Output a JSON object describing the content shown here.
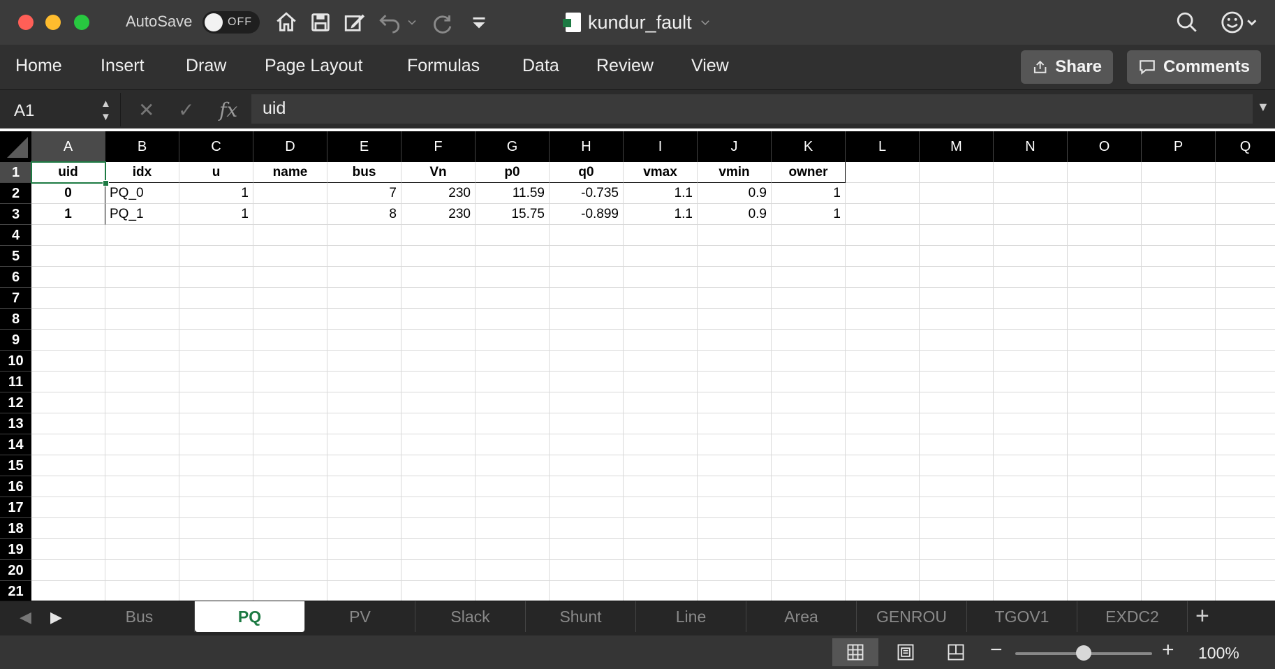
{
  "titlebar": {
    "autosave_label": "AutoSave",
    "autosave_state": "OFF",
    "document_title": "kundur_fault"
  },
  "ribbon": {
    "tabs": [
      "Home",
      "Insert",
      "Draw",
      "Page Layout",
      "Formulas",
      "Data",
      "Review",
      "View"
    ],
    "share_label": "Share",
    "comments_label": "Comments"
  },
  "formula_bar": {
    "name_box": "A1",
    "value": "uid"
  },
  "sheet": {
    "columns": [
      "A",
      "B",
      "C",
      "D",
      "E",
      "F",
      "G",
      "H",
      "I",
      "J",
      "K",
      "L",
      "M",
      "N",
      "O",
      "P",
      "Q"
    ],
    "rows": [
      "1",
      "2",
      "3",
      "4",
      "5",
      "6",
      "7",
      "8",
      "9",
      "10",
      "11",
      "12",
      "13",
      "14",
      "15",
      "16",
      "17",
      "18",
      "19",
      "20",
      "21"
    ],
    "header_row": [
      "uid",
      "idx",
      "u",
      "name",
      "bus",
      "Vn",
      "p0",
      "q0",
      "vmax",
      "vmin",
      "owner"
    ],
    "data_rows": [
      [
        "0",
        "PQ_0",
        "1",
        "",
        "7",
        "230",
        "11.59",
        "-0.735",
        "1.1",
        "0.9",
        "1"
      ],
      [
        "1",
        "PQ_1",
        "1",
        "",
        "8",
        "230",
        "15.75",
        "-0.899",
        "1.1",
        "0.9",
        "1"
      ]
    ]
  },
  "sheet_tabs": {
    "tabs": [
      "Bus",
      "PQ",
      "PV",
      "Slack",
      "Shunt",
      "Line",
      "Area",
      "GENROU",
      "TGOV1",
      "EXDC2"
    ],
    "active": "PQ"
  },
  "statusbar": {
    "zoom": "100%"
  },
  "colors": {
    "excel_green": "#1d7a43",
    "toolbar_bg": "#3b3b3b"
  }
}
